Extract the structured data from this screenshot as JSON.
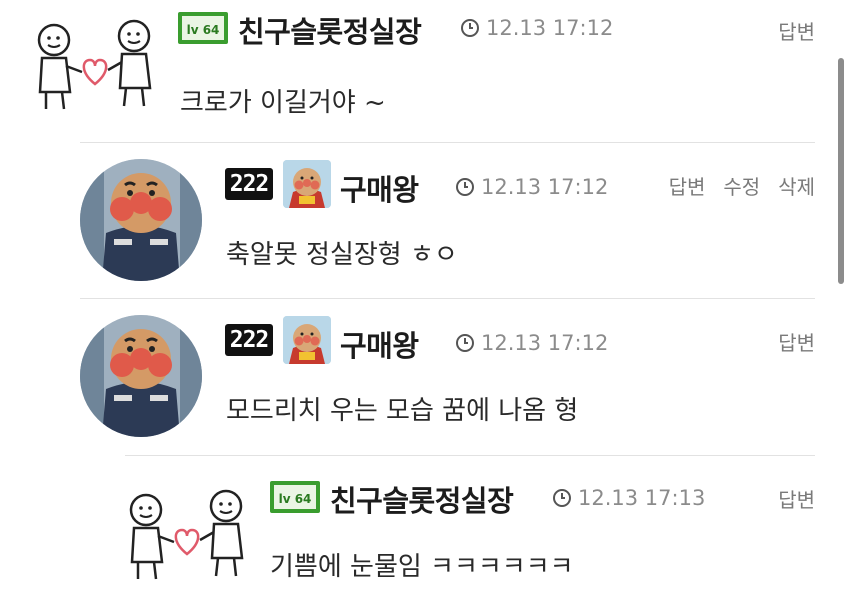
{
  "comments": [
    {
      "name": "친구슬롯정실장",
      "time": "12.13 17:12",
      "text": "크로가 이길거야 ~",
      "actions": [
        "답변"
      ],
      "badge": "lv",
      "level_badge_text": "lv 64"
    },
    {
      "name": "구매왕",
      "time": "12.13 17:12",
      "text": "축알못 정실장형 ㅎㅇ",
      "actions": [
        "답변",
        "수정",
        "삭제"
      ],
      "badge": "num",
      "num_badge_text": "222"
    },
    {
      "name": "구매왕",
      "time": "12.13 17:12",
      "text": "모드리치 우는 모습 꿈에 나옴 형",
      "actions": [
        "답변"
      ],
      "badge": "num",
      "num_badge_text": "222"
    },
    {
      "name": "친구슬롯정실장",
      "time": "12.13 17:13",
      "text": "기쁨에 눈물임 ㅋㅋㅋㅋㅋㅋ",
      "actions": [
        "답변"
      ],
      "badge": "lv",
      "level_badge_text": "lv 64"
    }
  ],
  "colors": {
    "level_badge_green": "#3a9d2f",
    "text": "#2a2a2a",
    "meta": "#8b8b8b"
  }
}
